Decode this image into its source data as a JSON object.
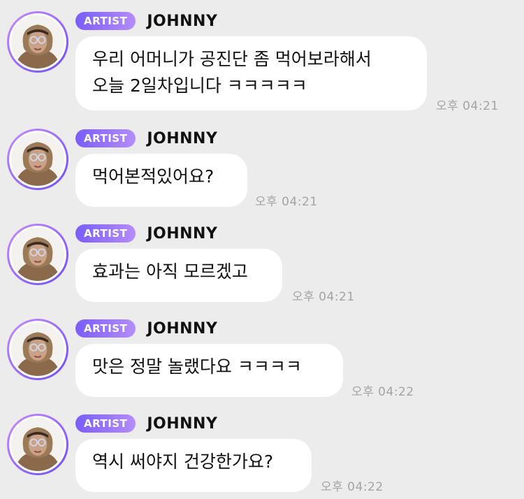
{
  "badge_label": "ARTIST",
  "author_name": "JOHNNY",
  "messages": [
    {
      "text_lines": [
        "우리 어머니가 공진단 좀 먹어보라해서",
        "오늘 2일차입니다 ㅋㅋㅋㅋㅋ"
      ],
      "time": "오후 04:21"
    },
    {
      "text_lines": [
        "먹어본적있어요?"
      ],
      "time": "오후 04:21"
    },
    {
      "text_lines": [
        "효과는 아직 모르겠고"
      ],
      "time": "오후 04:21"
    },
    {
      "text_lines": [
        "맛은 정말 놀랬다요 ㅋㅋㅋㅋ"
      ],
      "time": "오후 04:22"
    },
    {
      "text_lines": [
        "역시 써야지 건강한가요?"
      ],
      "time": "오후 04:22"
    }
  ],
  "colors": {
    "background": "#ececec",
    "bubble": "#ffffff",
    "badge_start": "#7a5cff",
    "badge_end": "#b58cff",
    "time": "#a3a3a3"
  },
  "icons": {
    "avatar": "artist-avatar-photo"
  }
}
